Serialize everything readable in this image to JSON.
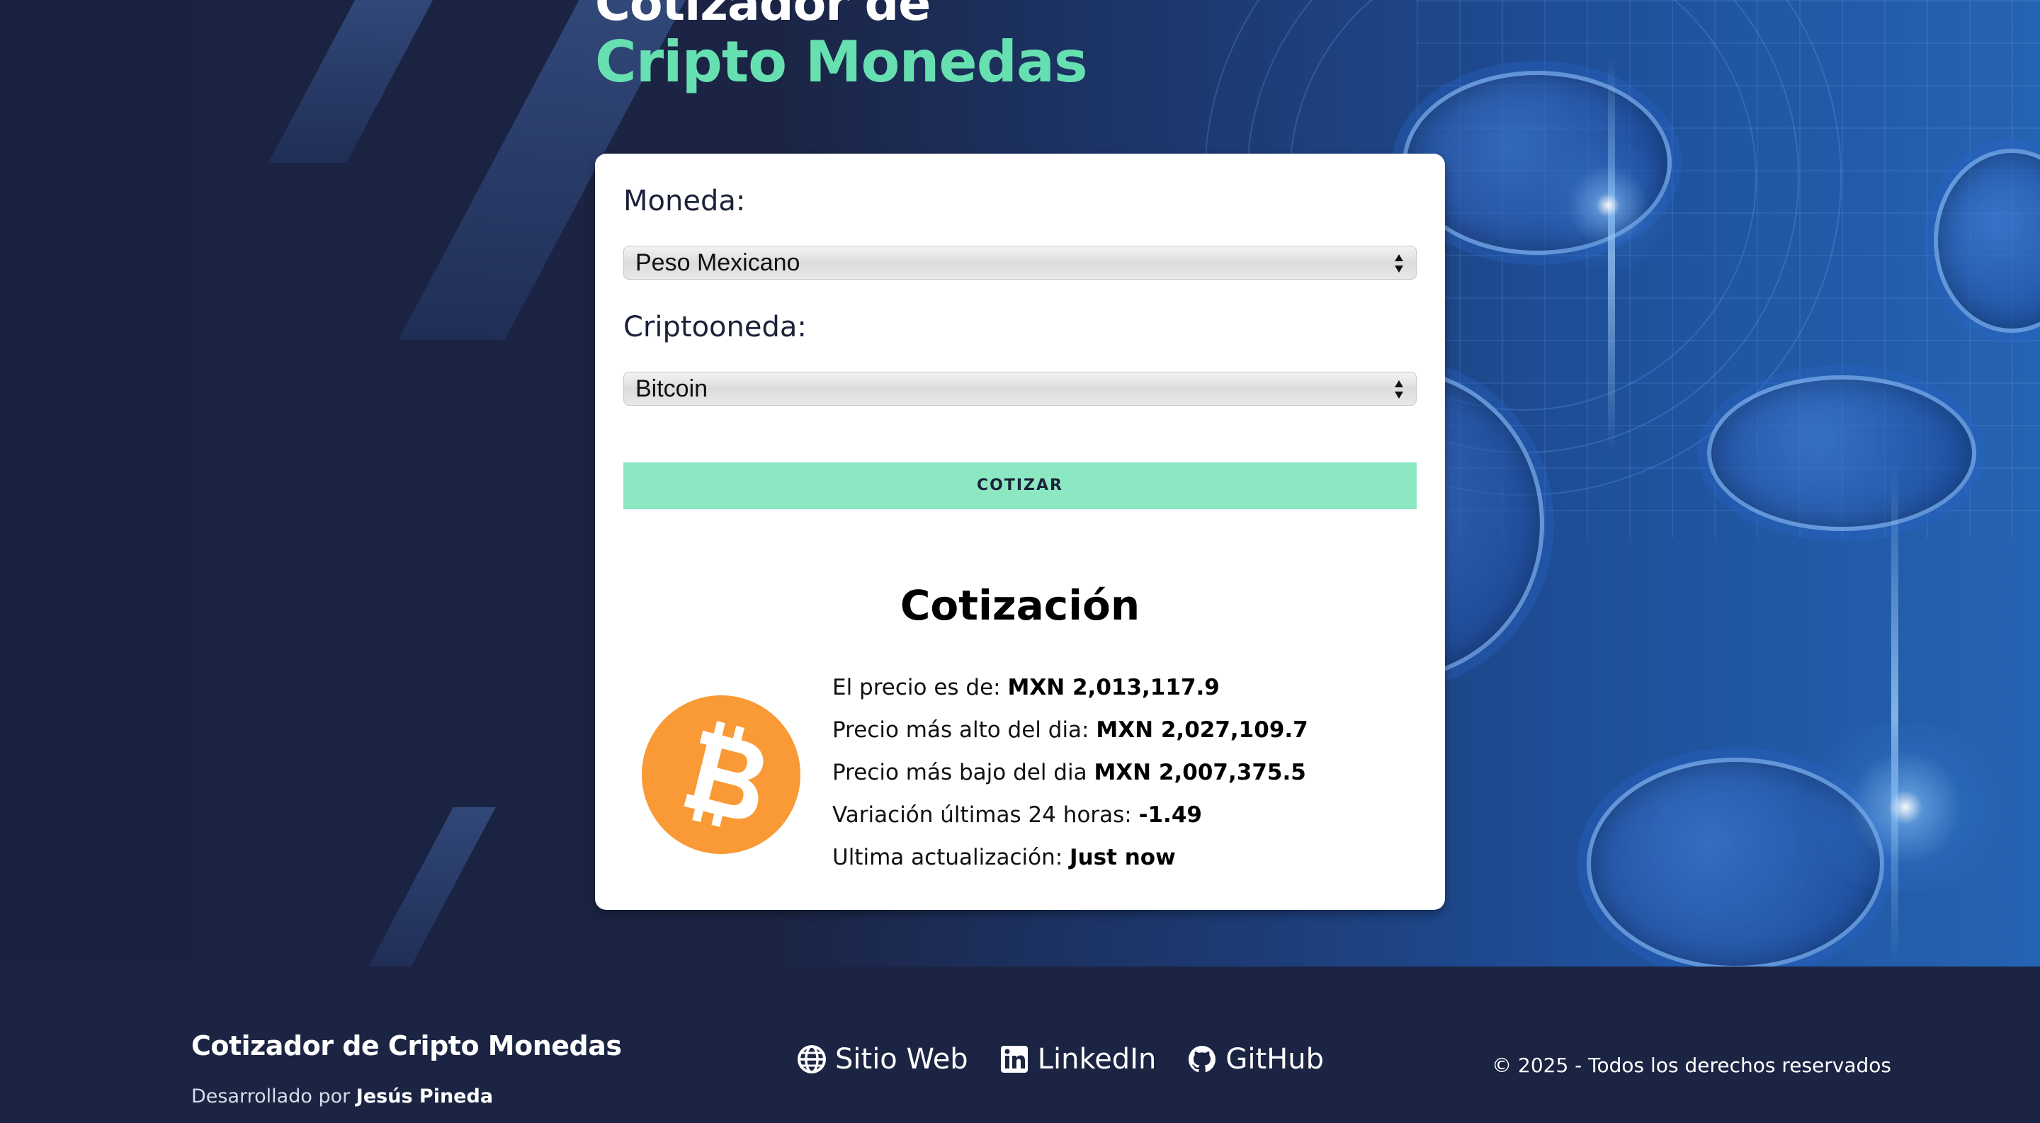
{
  "header": {
    "title_line1": "Cotizador de",
    "title_line2": "Cripto Monedas"
  },
  "form": {
    "currency_label": "Moneda:",
    "currency_value": "Peso Mexicano",
    "crypto_label": "Criptooneda:",
    "crypto_value": "Bitcoin",
    "submit_label": "Cotizar"
  },
  "result": {
    "heading": "Cotización",
    "coin_icon": "bitcoin-logo",
    "price_label": "El precio es de: ",
    "price_value": "MXN 2,013,117.9",
    "high_label": "Precio más alto del dia: ",
    "high_value": "MXN 2,027,109.7",
    "low_label": "Precio más bajo del dia ",
    "low_value": "MXN 2,007,375.5",
    "change_label": "Variación últimas 24 horas: ",
    "change_value": "-1.49",
    "updated_label": "Ultima actualización: ",
    "updated_value": "Just now"
  },
  "footer": {
    "brand": "Cotizador de Cripto Monedas",
    "dev_prefix": "Desarrollado por ",
    "dev_name": "Jesús Pineda",
    "links": [
      {
        "label": "Sitio Web",
        "icon": "globe-icon"
      },
      {
        "label": "LinkedIn",
        "icon": "linkedin-icon"
      },
      {
        "label": "GitHub",
        "icon": "github-icon"
      }
    ],
    "copyright": "© 2025 - Todos los derechos reservados"
  },
  "colors": {
    "accent": "#66e0b0",
    "button": "#8ce8c3",
    "navy": "#1b2442",
    "bitcoin": "#f7931a"
  }
}
